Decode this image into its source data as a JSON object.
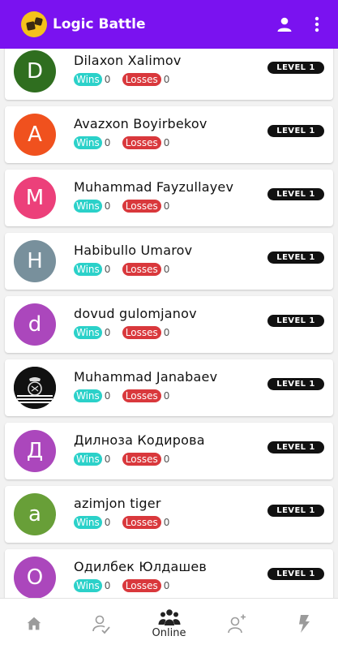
{
  "app": {
    "title": "Logic Battle"
  },
  "colors": {
    "appbar": "#7a12f0",
    "wins_badge": "#2bd1c9",
    "losses_badge": "#d9383c",
    "level_badge": "#111111"
  },
  "players": [
    {
      "initial": "D",
      "name": "Dilaxon Xalimov",
      "wins_label": "Wins",
      "wins": "0",
      "losses_label": "Losses",
      "losses": "0",
      "level": "LEVEL 1",
      "avatar_color": "#2f6e1f"
    },
    {
      "initial": "A",
      "name": "Avazxon Boyirbekov",
      "wins_label": "Wins",
      "wins": "0",
      "losses_label": "Losses",
      "losses": "0",
      "level": "LEVEL 1",
      "avatar_color": "#f0511e"
    },
    {
      "initial": "M",
      "name": "Muhammad Fayzullayev",
      "wins_label": "Wins",
      "wins": "0",
      "losses_label": "Losses",
      "losses": "0",
      "level": "LEVEL 1",
      "avatar_color": "#ec407a"
    },
    {
      "initial": "H",
      "name": "Habibullo Umarov",
      "wins_label": "Wins",
      "wins": "0",
      "losses_label": "Losses",
      "losses": "0",
      "level": "LEVEL 1",
      "avatar_color": "#78909c"
    },
    {
      "initial": "d",
      "name": "dovud gulomjanov",
      "wins_label": "Wins",
      "wins": "0",
      "losses_label": "Losses",
      "losses": "0",
      "level": "LEVEL 1",
      "avatar_color": "#ab47bc"
    },
    {
      "initial": "",
      "name": "Muhammad Janabaev",
      "wins_label": "Wins",
      "wins": "0",
      "losses_label": "Losses",
      "losses": "0",
      "level": "LEVEL 1",
      "avatar_color": "#111111",
      "photo": "football-club-logo"
    },
    {
      "initial": "Д",
      "name": "Дилноза Кодирова",
      "wins_label": "Wins",
      "wins": "0",
      "losses_label": "Losses",
      "losses": "0",
      "level": "LEVEL 1",
      "avatar_color": "#ab47bc"
    },
    {
      "initial": "a",
      "name": "azimjon tiger",
      "wins_label": "Wins",
      "wins": "0",
      "losses_label": "Losses",
      "losses": "0",
      "level": "LEVEL 1",
      "avatar_color": "#689f38"
    },
    {
      "initial": "О",
      "name": "Одилбек Юлдашев",
      "wins_label": "Wins",
      "wins": "0",
      "losses_label": "Losses",
      "losses": "0",
      "level": "LEVEL 1",
      "avatar_color": "#ab47bc"
    }
  ],
  "bottom_nav": [
    {
      "id": "home",
      "icon": "home-icon",
      "label": ""
    },
    {
      "id": "friends",
      "icon": "user-check-icon",
      "label": ""
    },
    {
      "id": "online",
      "icon": "group-icon",
      "label": "Online",
      "active": true
    },
    {
      "id": "add-friend",
      "icon": "user-plus-icon",
      "label": ""
    },
    {
      "id": "battle",
      "icon": "lightning-icon",
      "label": ""
    }
  ]
}
